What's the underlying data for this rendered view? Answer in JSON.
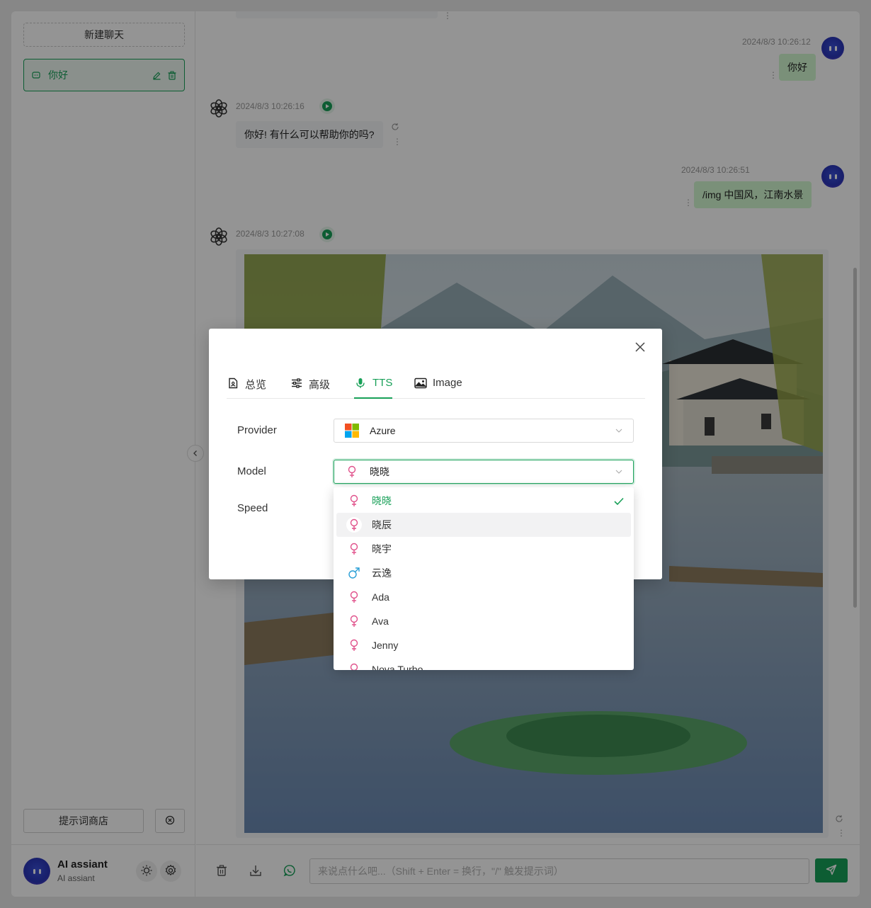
{
  "sidebar": {
    "new_chat": "新建聊天",
    "chat_items": [
      {
        "label": "你好"
      }
    ],
    "prompt_store": "提示词商店",
    "user": {
      "name": "AI assiant",
      "subtitle": "AI assiant"
    }
  },
  "messages": [
    {
      "role": "user",
      "time": "2024/8/3 10:26:12",
      "text": "你好"
    },
    {
      "role": "assistant",
      "time": "2024/8/3 10:26:16",
      "text": "你好! 有什么可以帮助你的吗?"
    },
    {
      "role": "user",
      "time": "2024/8/3 10:26:51",
      "text": "/img 中国风，江南水景"
    },
    {
      "role": "assistant",
      "time": "2024/8/3 10:27:08",
      "image": "jiangnan-water-village-landscape"
    }
  ],
  "input": {
    "placeholder": "来说点什么吧...（Shift + Enter = 换行，\"/\" 触发提示词）",
    "value": ""
  },
  "modal": {
    "tabs": [
      {
        "label": "总览",
        "icon": "document-icon"
      },
      {
        "label": "高级",
        "icon": "sliders-icon"
      },
      {
        "label": "TTS",
        "icon": "microphone-icon",
        "active": true
      },
      {
        "label": "Image",
        "icon": "image-icon"
      }
    ],
    "fields": {
      "provider": {
        "label": "Provider",
        "value": "Azure",
        "icon": "microsoft-icon"
      },
      "model": {
        "label": "Model",
        "value": "晓晓",
        "icon": "female-icon"
      },
      "speed": {
        "label": "Speed"
      }
    },
    "model_options": [
      {
        "label": "晓晓",
        "gender": "female",
        "selected": true
      },
      {
        "label": "晓辰",
        "gender": "female",
        "hover": true
      },
      {
        "label": "晓宇",
        "gender": "female"
      },
      {
        "label": "云逸",
        "gender": "male"
      },
      {
        "label": "Ada",
        "gender": "female"
      },
      {
        "label": "Ava",
        "gender": "female"
      },
      {
        "label": "Jenny",
        "gender": "female"
      },
      {
        "label": "Nova Turbo",
        "gender": "female"
      }
    ]
  },
  "colors": {
    "accent": "#18a058",
    "female": "#e0508a",
    "male": "#2a9fd6",
    "user_bubble": "#d2f9d1",
    "bot_bubble": "#f4f6f8"
  }
}
